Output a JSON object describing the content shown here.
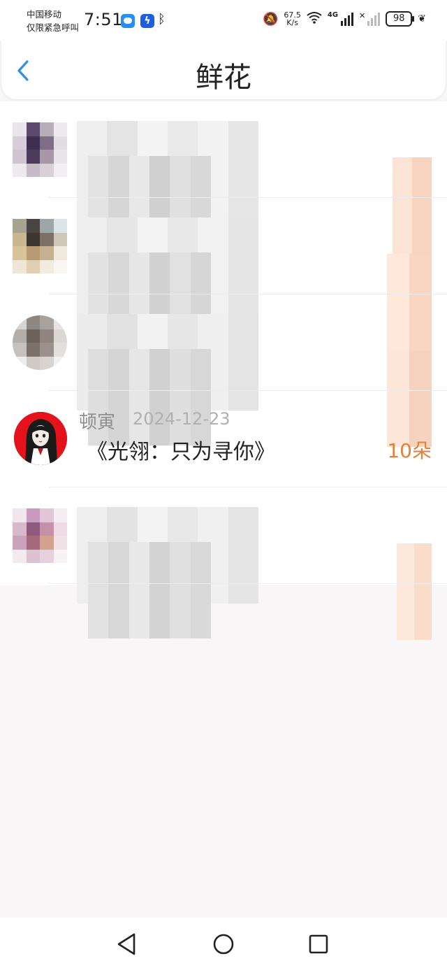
{
  "status_bar": {
    "carrier_line1": "中国移动",
    "carrier_line2": "仅限紧急呼叫",
    "time": "7:51",
    "net_speed_value": "67.5",
    "net_speed_unit": "K/s",
    "network_type": "4G",
    "battery": "98"
  },
  "header": {
    "title": "鲜花"
  },
  "list": {
    "items": [
      {
        "name": "",
        "date": "",
        "book": "",
        "count": "",
        "obscured": true
      },
      {
        "name": "",
        "date": "",
        "book": "",
        "count": "",
        "obscured": true
      },
      {
        "name": "",
        "date": "",
        "book": "",
        "count": "",
        "obscured": true
      },
      {
        "name": "顿寅",
        "date": "2024-12-23",
        "book": "《光翎：只为寻你》",
        "count": "10朵",
        "obscured": false
      },
      {
        "name": "",
        "date": "",
        "book": "",
        "count": "",
        "obscured": true
      }
    ]
  },
  "colors": {
    "accent_blue": "#2f8ee6",
    "count_orange": "#e2813d",
    "avatar_red": "#e4121a"
  },
  "nav": {
    "icons": [
      "back-triangle-icon",
      "home-circle-icon",
      "recents-square-icon"
    ]
  }
}
